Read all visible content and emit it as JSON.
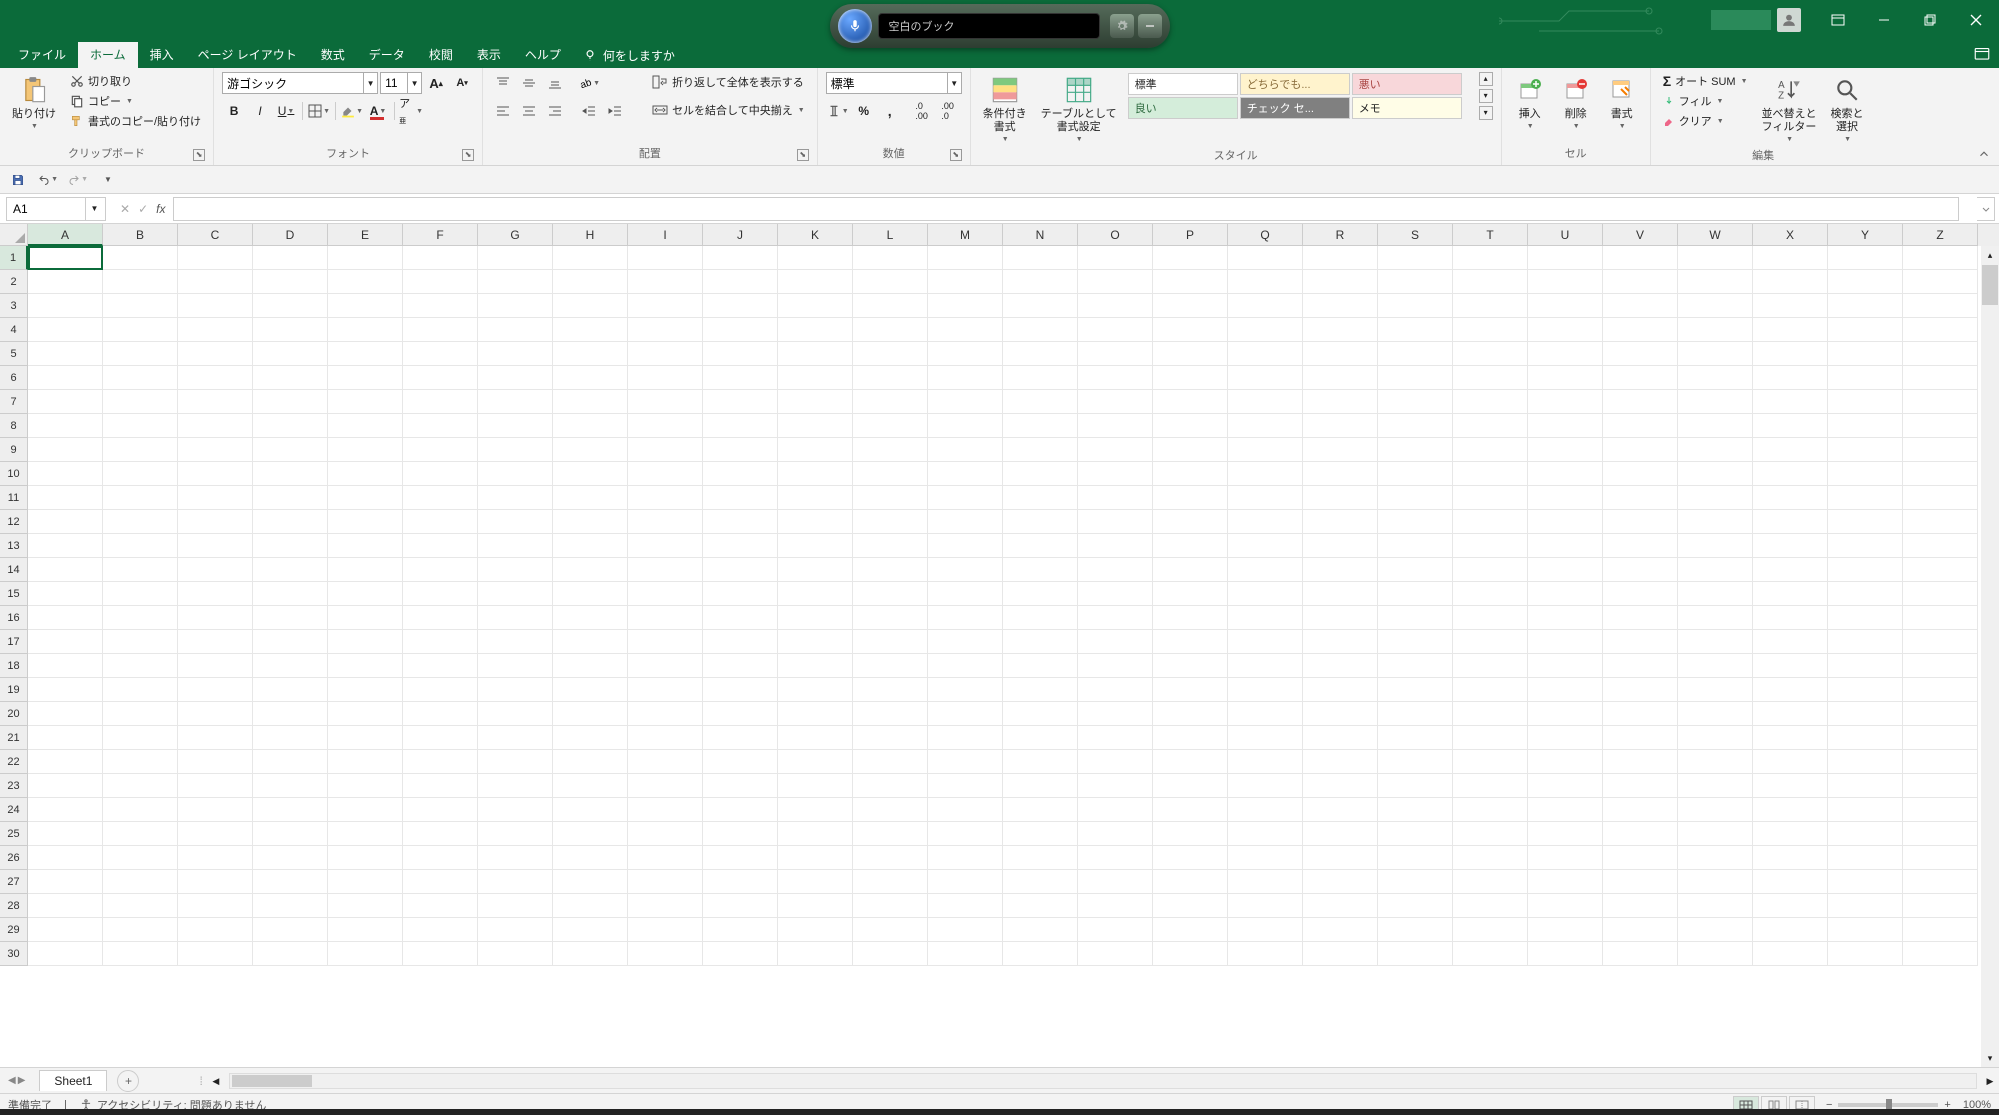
{
  "voice_widget": {
    "display_text": "空白のブック"
  },
  "tabs": {
    "file": "ファイル",
    "home": "ホーム",
    "insert": "挿入",
    "page_layout": "ページ レイアウト",
    "formulas": "数式",
    "data": "データ",
    "review": "校閲",
    "view": "表示",
    "help": "ヘルプ",
    "tell_me": "何をしますか"
  },
  "ribbon": {
    "clipboard": {
      "paste": "貼り付け",
      "cut": "切り取り",
      "copy": "コピー",
      "format_painter": "書式のコピー/貼り付け",
      "label": "クリップボード"
    },
    "font": {
      "name": "游ゴシック",
      "size": "11",
      "label": "フォント"
    },
    "alignment": {
      "wrap_text": "折り返して全体を表示する",
      "merge_center": "セルを結合して中央揃え",
      "label": "配置"
    },
    "number": {
      "format": "標準",
      "label": "数値"
    },
    "styles": {
      "conditional": "条件付き\n書式",
      "format_table": "テーブルとして\n書式設定",
      "cells": {
        "c1": "標準",
        "c2": "どちらでも...",
        "c3": "悪い",
        "c4": "良い",
        "c5": "チェック セ...",
        "c6": "メモ"
      },
      "label": "スタイル"
    },
    "cells_grp": {
      "insert": "挿入",
      "delete": "削除",
      "format": "書式",
      "label": "セル"
    },
    "editing": {
      "autosum": "オート SUM",
      "fill": "フィル",
      "clear": "クリア",
      "sort_filter": "並べ替えと\nフィルター",
      "find_select": "検索と\n選択",
      "label": "編集"
    }
  },
  "name_box": "A1",
  "columns": [
    "A",
    "B",
    "C",
    "D",
    "E",
    "F",
    "G",
    "H",
    "I",
    "J",
    "K",
    "L",
    "M",
    "N",
    "O",
    "P",
    "Q",
    "R",
    "S",
    "T",
    "U",
    "V",
    "W",
    "X",
    "Y",
    "Z"
  ],
  "row_count": 30,
  "active_cell": {
    "row": 1,
    "col": "A"
  },
  "sheet_tab": "Sheet1",
  "status": {
    "ready": "準備完了",
    "accessibility": "アクセシビリティ: 問題ありません",
    "zoom": "100%"
  }
}
